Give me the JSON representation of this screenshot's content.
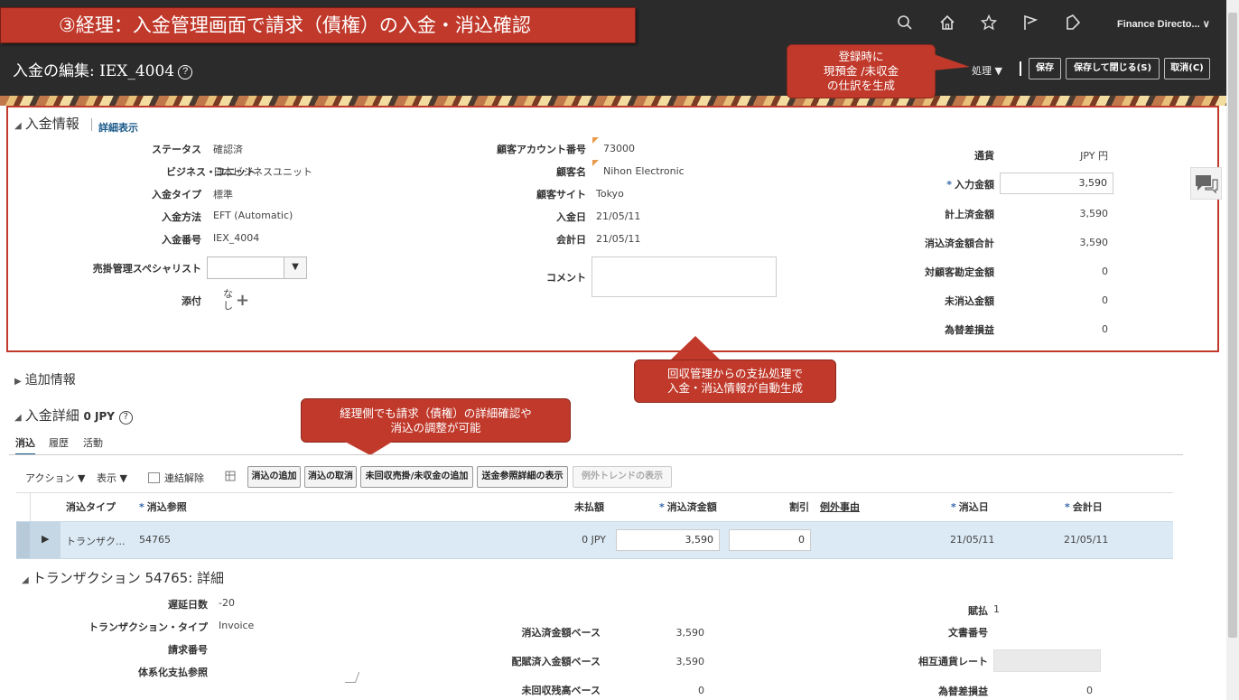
{
  "slide_title": "③経理：入金管理画面で請求（債権）の入金・消込確認",
  "topbar": {
    "icons": [
      "search-icon",
      "home-icon",
      "star-icon",
      "flag-icon",
      "bell-icon"
    ],
    "user": "Finance Directo..."
  },
  "page": {
    "title": "入金の編集: IEX_4004",
    "help_icon": "?"
  },
  "toolbar": {
    "actions": "処理",
    "save": "保存",
    "save_close": "保存して閉じる(S)",
    "cancel": "取消(C)"
  },
  "callouts": {
    "top": "登録時に\n現預金 /未収金\nの仕訳を生成",
    "middle": "回収管理からの支払処理で\n入金・消込情報が自動生成",
    "left": "経理側でも請求（債権）の詳細確認や\n消込の調整が可能"
  },
  "receipt_info": {
    "heading": "入金情報",
    "detail_link": "詳細表示",
    "col1": [
      {
        "label": "ステータス",
        "value": "確認済"
      },
      {
        "label": "ビジネス・ユニット",
        "value": "日本ビジネスユニット"
      },
      {
        "label": "入金タイプ",
        "value": "標準"
      },
      {
        "label": "入金方法",
        "value": "EFT (Automatic)"
      },
      {
        "label": "入金番号",
        "value": "IEX_4004"
      }
    ],
    "specialist_label": "売掛管理スペシャリスト",
    "attachment_label": "添付",
    "attachment_value": "なし",
    "col2": [
      {
        "label": "顧客アカウント番号",
        "value": "73000"
      },
      {
        "label": "顧客名",
        "value": "Nihon Electronic"
      },
      {
        "label": "顧客サイト",
        "value": "Tokyo"
      },
      {
        "label": "入金日",
        "value": "21/05/11"
      },
      {
        "label": "会計日",
        "value": "21/05/11"
      }
    ],
    "comment_label": "コメント",
    "col3": [
      {
        "label": "通貨",
        "value": "JPY 円"
      },
      {
        "label": "入力金額",
        "value": "3,590"
      },
      {
        "label": "計上済金額",
        "value": "3,590"
      },
      {
        "label": "消込済金額合計",
        "value": "3,590"
      },
      {
        "label": "対顧客勘定金額",
        "value": "0"
      },
      {
        "label": "未消込金額",
        "value": "0"
      },
      {
        "label": "為替差損益",
        "value": "0"
      }
    ]
  },
  "additional_info": "追加情報",
  "receipt_detail": {
    "heading": "入金詳細",
    "amount": "0 JPY",
    "tabs": [
      "消込",
      "履歴",
      "活動"
    ]
  },
  "table_toolbar": {
    "actions": "アクション",
    "view": "表示",
    "detach": "連結解除",
    "buttons": [
      "消込の追加",
      "消込の取消",
      "未回収売掛/未収金の追加",
      "送金参照詳細の表示",
      "例外トレンドの表示"
    ]
  },
  "table": {
    "headers": [
      "消込タイプ",
      "消込参照",
      "未払額",
      "消込済金額",
      "割引",
      "例外事由",
      "消込日",
      "会計日"
    ],
    "rows": [
      {
        "type": "トランザク...",
        "ref": "54765",
        "unpaid": "0 JPY",
        "applied": "3,590",
        "discount": "0",
        "reason": "",
        "apply_date": "21/05/11",
        "acct_date": "21/05/11"
      }
    ]
  },
  "transaction_detail": {
    "heading": "トランザクション 54765: 詳細",
    "left": [
      {
        "label": "遅延日数",
        "value": "-20"
      },
      {
        "label": "トランザクション・タイプ",
        "value": "Invoice"
      },
      {
        "label": "請求番号",
        "value": ""
      },
      {
        "label": "体系化支払参照",
        "value": ""
      }
    ],
    "middle": [
      {
        "label": "消込済金額ベース",
        "value": "3,590"
      },
      {
        "label": "配賦済入金額ベース",
        "value": "3,590"
      },
      {
        "label": "未回収残高ベース",
        "value": "0"
      }
    ],
    "right": [
      {
        "label": "賦払",
        "value": "1"
      },
      {
        "label": "文書番号",
        "value": ""
      },
      {
        "label": "相互通貨レート",
        "value": ""
      },
      {
        "label": "為替差損益",
        "value": "0"
      }
    ]
  }
}
